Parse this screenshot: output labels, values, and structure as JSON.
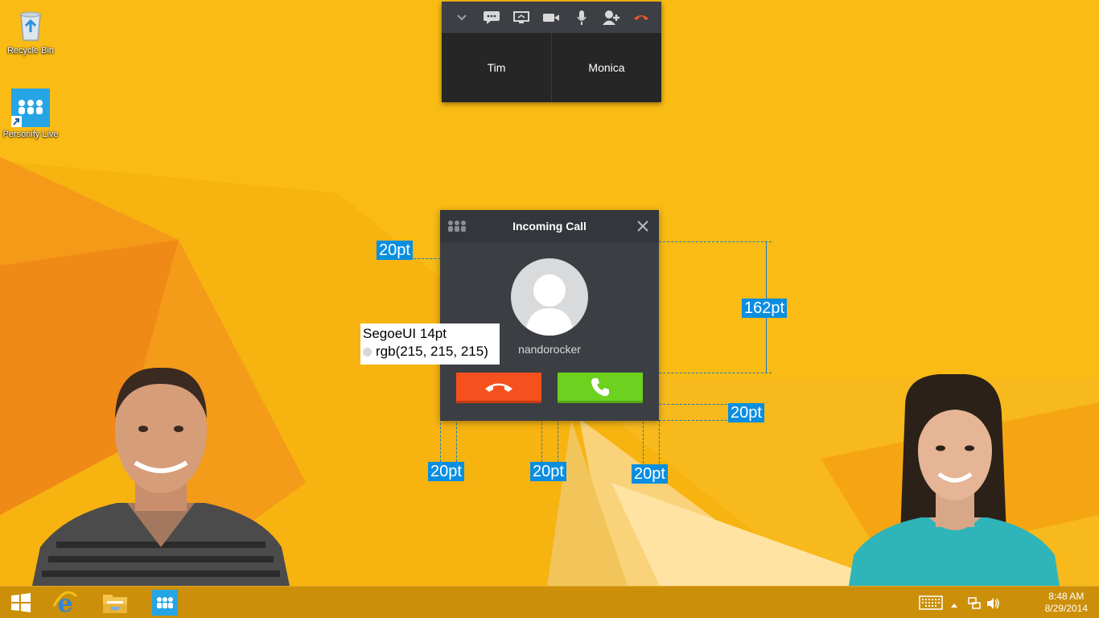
{
  "desktop": {
    "icons": [
      {
        "label": "Recycle Bin",
        "icon": "recycle-bin-icon"
      },
      {
        "label": "Personify Live",
        "icon": "personify-live-icon"
      }
    ]
  },
  "mini_call": {
    "toolbar": [
      "chevron-down-icon",
      "chat-icon",
      "screen-share-icon",
      "video-camera-icon",
      "microphone-icon",
      "add-user-icon",
      "hang-up-icon"
    ],
    "participants": [
      "Tim",
      "Monica"
    ]
  },
  "incoming_call": {
    "title": "Incoming Call",
    "caller": "nandorocker",
    "colors": {
      "decline": "#f5501e",
      "accept": "#6cd11f",
      "name_text": "#d7d7d7"
    }
  },
  "annotations": {
    "top_padding": "20pt",
    "height": "162pt",
    "bottom_padding": "20pt",
    "left_gap": "20pt",
    "middle_gap": "20pt",
    "right_gap": "20pt",
    "font_name": "SegoeUI 14pt",
    "font_color": "rgb(215, 215, 215)"
  },
  "taskbar": {
    "items": [
      "windows-start-icon",
      "internet-explorer-icon",
      "file-explorer-icon",
      "personify-icon"
    ],
    "tray": [
      "keyboard-icon",
      "show-hidden-icon",
      "network-icon",
      "volume-icon"
    ],
    "time": "8:48 AM",
    "date": "8/29/2014"
  }
}
